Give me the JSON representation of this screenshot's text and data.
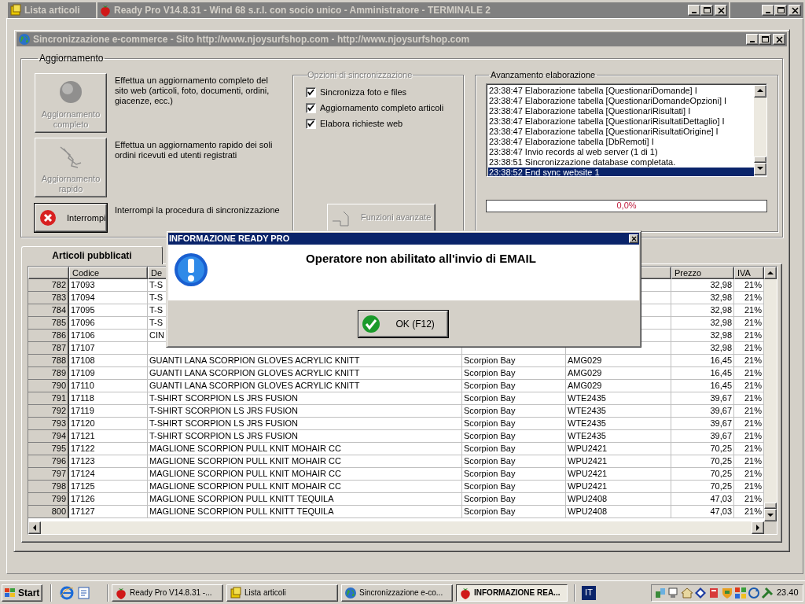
{
  "minimized_window": {
    "title": "Lista articoli"
  },
  "main_window": {
    "title": "Ready Pro V14.8.31 - Wind 68 s.r.l. con socio unico - Amministratore - TERMINALE 2"
  },
  "sync_window": {
    "title": "Sincronizzazione e-commerce - Sito http://www.njoysurfshop.com - http://www.njoysurfshop.com",
    "update_group": {
      "label": "Aggiornamento",
      "actions": [
        {
          "kind": "full",
          "button": "Aggiornamento completo",
          "disabled": true,
          "description": "Effettua un aggiornamento completo del sito web (articoli, foto, documenti, ordini, giacenze, ecc.)"
        },
        {
          "kind": "quick",
          "button": "Aggiornamento rapido",
          "disabled": true,
          "description": "Effettua un aggiornamento rapido dei soli ordini ricevuti ed utenti registrati"
        },
        {
          "kind": "stop",
          "button": "Interrompi",
          "disabled": false,
          "description": "Interrompi la procedura di sincronizzazione"
        }
      ]
    },
    "options": {
      "label": "Opzioni di sincronizzazione",
      "disabled": true,
      "checkboxes": [
        {
          "label": "Sincronizza foto e files",
          "checked": true
        },
        {
          "label": "Aggiornamento completo articoli",
          "checked": true
        },
        {
          "label": "Elabora richieste web",
          "checked": true
        }
      ],
      "advanced_button": {
        "label": "Funzioni avanzate",
        "disabled": true
      }
    },
    "progress": {
      "label": "Avanzamento elaborazione",
      "log": [
        {
          "text": "23:38:47 Elaborazione tabella [QuestionariDomande] I",
          "selected": false
        },
        {
          "text": "23:38:47 Elaborazione tabella [QuestionariDomandeOpzioni] I",
          "selected": false
        },
        {
          "text": "23:38:47 Elaborazione tabella [QuestionariRisultati] I",
          "selected": false
        },
        {
          "text": "23:38:47 Elaborazione tabella [QuestionariRisultatiDettaglio] I",
          "selected": false
        },
        {
          "text": "23:38:47 Elaborazione tabella [QuestionariRisultatiOrigine] I",
          "selected": false
        },
        {
          "text": "23:38:47 Elaborazione tabella [DbRemoti] I",
          "selected": false
        },
        {
          "text": "23:38:47 Invio records al web server (1 di 1)",
          "selected": false
        },
        {
          "text": "23:38:51 Sincronizzazione database completata.",
          "selected": false
        },
        {
          "text": "23:38:52 End sync website 1",
          "selected": true
        }
      ],
      "level": 0,
      "reading": "0,0%"
    },
    "tabs": [
      {
        "label": "Articoli pubblicati",
        "selected": true
      }
    ],
    "table": {
      "columns": [
        {
          "label": "Codice"
        },
        {
          "label": "De"
        },
        {},
        {},
        {
          "label": "Prezzo"
        },
        {
          "label": "IVA"
        }
      ],
      "rows": [
        {
          "number": "782",
          "codice": "17093",
          "descrizione": "T-S",
          "prezzo": "32,98",
          "iva": "21%"
        },
        {
          "number": "783",
          "codice": "17094",
          "descrizione": "T-S",
          "prezzo": "32,98",
          "iva": "21%"
        },
        {
          "number": "784",
          "codice": "17095",
          "descrizione": "T-S",
          "prezzo": "32,98",
          "iva": "21%"
        },
        {
          "number": "785",
          "codice": "17096",
          "descrizione": "T-S",
          "prezzo": "32,98",
          "iva": "21%"
        },
        {
          "number": "786",
          "codice": "17106",
          "descrizione": "CIN",
          "prezzo": "32,98",
          "iva": "21%"
        },
        {
          "number": "787",
          "codice": "17107",
          "prezzo": "32,98",
          "iva": "21%"
        },
        {
          "number": "788",
          "codice": "17108",
          "descrizione": "GUANTI LANA SCORPION GLOVES ACRYLIC KNITT",
          "column_4": "Scorpion Bay",
          "column_5": "AMG029",
          "prezzo": "16,45",
          "iva": "21%"
        },
        {
          "number": "789",
          "codice": "17109",
          "descrizione": "GUANTI LANA SCORPION GLOVES ACRYLIC KNITT",
          "column_4": "Scorpion Bay",
          "column_5": "AMG029",
          "prezzo": "16,45",
          "iva": "21%"
        },
        {
          "number": "790",
          "codice": "17110",
          "descrizione": "GUANTI LANA SCORPION GLOVES ACRYLIC KNITT",
          "column_4": "Scorpion Bay",
          "column_5": "AMG029",
          "prezzo": "16,45",
          "iva": "21%"
        },
        {
          "number": "791",
          "codice": "17118",
          "descrizione": "T-SHIRT SCORPION LS JRS FUSION",
          "column_4": "Scorpion Bay",
          "column_5": "WTE2435",
          "prezzo": "39,67",
          "iva": "21%"
        },
        {
          "number": "792",
          "codice": "17119",
          "descrizione": "T-SHIRT SCORPION LS JRS FUSION",
          "column_4": "Scorpion Bay",
          "column_5": "WTE2435",
          "prezzo": "39,67",
          "iva": "21%"
        },
        {
          "number": "793",
          "codice": "17120",
          "descrizione": "T-SHIRT SCORPION LS JRS FUSION",
          "column_4": "Scorpion Bay",
          "column_5": "WTE2435",
          "prezzo": "39,67",
          "iva": "21%"
        },
        {
          "number": "794",
          "codice": "17121",
          "descrizione": "T-SHIRT SCORPION LS JRS FUSION",
          "column_4": "Scorpion Bay",
          "column_5": "WTE2435",
          "prezzo": "39,67",
          "iva": "21%"
        },
        {
          "number": "795",
          "codice": "17122",
          "descrizione": "MAGLIONE SCORPION PULL KNIT MOHAIR CC",
          "column_4": "Scorpion Bay",
          "column_5": "WPU2421",
          "prezzo": "70,25",
          "iva": "21%"
        },
        {
          "number": "796",
          "codice": "17123",
          "descrizione": "MAGLIONE SCORPION PULL KNIT MOHAIR CC",
          "column_4": "Scorpion Bay",
          "column_5": "WPU2421",
          "prezzo": "70,25",
          "iva": "21%"
        },
        {
          "number": "797",
          "codice": "17124",
          "descrizione": "MAGLIONE SCORPION PULL KNIT MOHAIR CC",
          "column_4": "Scorpion Bay",
          "column_5": "WPU2421",
          "prezzo": "70,25",
          "iva": "21%"
        },
        {
          "number": "798",
          "codice": "17125",
          "descrizione": "MAGLIONE SCORPION PULL KNIT MOHAIR CC",
          "column_4": "Scorpion Bay",
          "column_5": "WPU2421",
          "prezzo": "70,25",
          "iva": "21%"
        },
        {
          "number": "799",
          "codice": "17126",
          "descrizione": "MAGLIONE SCORPION PULL KNITT TEQUILA",
          "column_4": "Scorpion Bay",
          "column_5": "WPU2408",
          "prezzo": "47,03",
          "iva": "21%"
        },
        {
          "number": "800",
          "codice": "17127",
          "descrizione": "MAGLIONE SCORPION PULL KNITT TEQUILA",
          "column_4": "Scorpion Bay",
          "column_5": "WPU2408",
          "prezzo": "47,03",
          "iva": "21%"
        }
      ]
    }
  },
  "dialog": {
    "title": "INFORMAZIONE READY PRO",
    "message": "Operatore non abilitato all'invio di EMAIL",
    "button": "OK (F12)"
  },
  "taskbar": {
    "start": "Start",
    "tasks": [
      {
        "label": "Ready Pro V14.8.31 -...",
        "kind": "app",
        "selected": false
      },
      {
        "label": "Lista articoli",
        "kind": "list",
        "selected": false
      },
      {
        "label": "Sincronizzazione e-co...",
        "kind": "globe",
        "selected": false
      },
      {
        "label": "INFORMAZIONE REA...",
        "kind": "app",
        "selected": true
      }
    ],
    "language": "IT",
    "clock": "23.40"
  }
}
